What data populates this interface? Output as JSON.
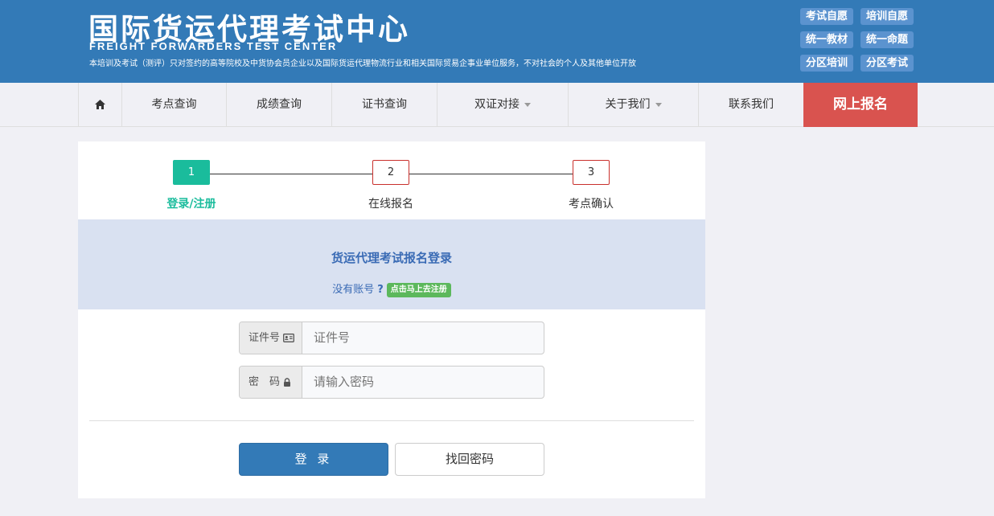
{
  "header": {
    "title_cn": "国际货运代理考试中心",
    "title_en": "FREIGHT FORWARDERS TEST CENTER",
    "note": "本培训及考试（测评）只对签约的高等院校及中货协会员企业以及国际货运代理物流行业和相关国际贸易企事业单位服务，不对社会的个人及其他单位开放",
    "buttons": [
      "考试自愿",
      "培训自愿",
      "统一教材",
      "统一命题",
      "分区培训",
      "分区考试"
    ]
  },
  "nav": {
    "home_icon": "home-icon",
    "items": [
      "考点查询",
      "成绩查询",
      "证书查询",
      "双证对接",
      "关于我们",
      "联系我们"
    ],
    "cta": "网上报名"
  },
  "steps": [
    {
      "num": "1",
      "label": "登录/注册"
    },
    {
      "num": "2",
      "label": "在线报名"
    },
    {
      "num": "3",
      "label": "考点确认"
    }
  ],
  "login": {
    "title": "货运代理考试报名登录",
    "no_account": "没有账号",
    "question": "?",
    "register_link": "点击马上去注册",
    "id_label": "证件号",
    "id_placeholder": "证件号",
    "pwd_label": "密　码",
    "pwd_placeholder": "请输入密码",
    "login_btn": "登 录",
    "forgot_btn": "找回密码"
  },
  "colors": {
    "header_bg": "#337ab7",
    "cta_bg": "#d9534f",
    "active_step": "#1abc9c",
    "banner_bg": "#d9e1f1"
  }
}
